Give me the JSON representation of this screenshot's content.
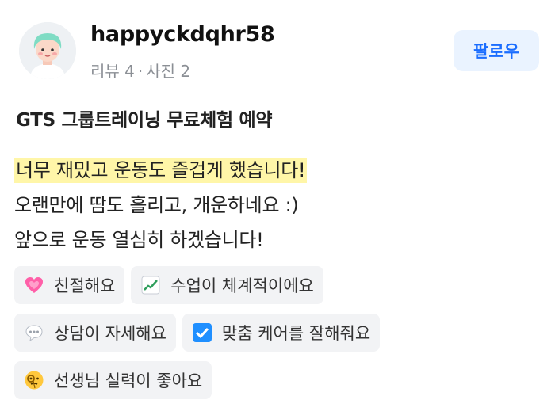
{
  "user": {
    "name": "happyckdqhr58",
    "review_label": "리뷰 4",
    "photo_label": "사진 2",
    "separator": "·"
  },
  "follow_label": "팔로우",
  "program_title": "GTS 그룹트레이닝 무료체험 예약",
  "review": {
    "highlighted_line": "너무 재밌고 운동도 즐겁게 했습니다!",
    "line2": "오랜만에 땀도 흘리고, 개운하네요 :)",
    "line3": "앞으로 운동 열심히 하겠습니다!"
  },
  "tags": [
    {
      "label": "친절해요",
      "icon": "heart-icon"
    },
    {
      "label": "수업이 체계적이에요",
      "icon": "chart-increasing-icon"
    },
    {
      "label": "상담이 자세해요",
      "icon": "speech-bubble-icon"
    },
    {
      "label": "맞춤 케어를 잘해줘요",
      "icon": "checkbox-icon"
    },
    {
      "label": "선생님 실력이 좋아요",
      "icon": "face-with-monocle-icon"
    }
  ],
  "colors": {
    "accent": "#1a6dff",
    "follow_bg": "#eaf3ff",
    "highlight": "#fff6a8",
    "tag_bg": "#f2f3f5"
  }
}
